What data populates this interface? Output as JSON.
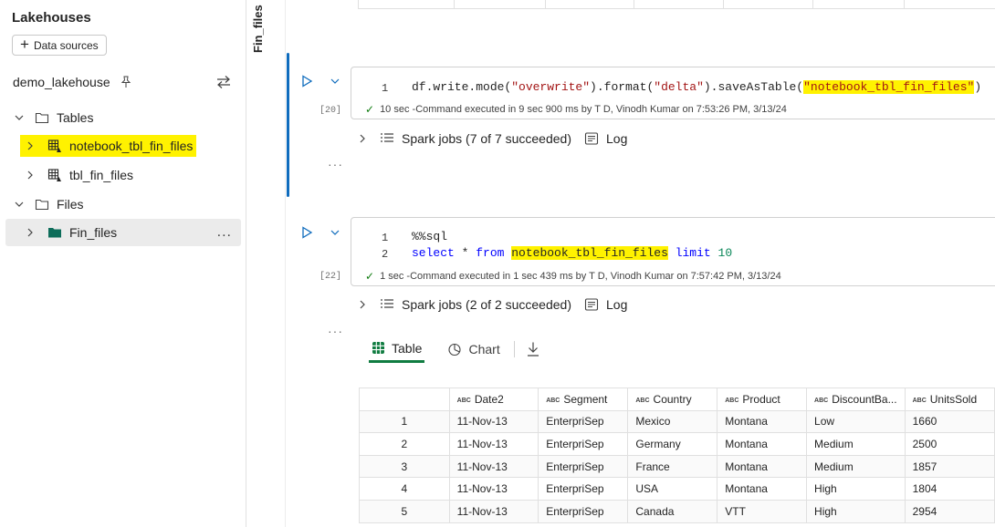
{
  "explorer": {
    "title": "Lakehouses",
    "data_sources_label": "Data sources",
    "lakehouse_name": "demo_lakehouse",
    "tables_label": "Tables",
    "tables": [
      "notebook_tbl_fin_files",
      "tbl_fin_files"
    ],
    "files_label": "Files",
    "files": [
      "Fin_files"
    ],
    "more_label": "..."
  },
  "side_tab": {
    "label": "Fin_files"
  },
  "cells": [
    {
      "exec_count": "[20]",
      "lines": [
        {
          "num": "1",
          "prefix": "df.write.mode(",
          "s1": "\"overwrite\"",
          "mid": ").format(",
          "s2": "\"delta\"",
          "mid2": ").saveAsTable(",
          "s3": "\"notebook_tbl_fin_files\"",
          "end": ")"
        }
      ],
      "status": "10 sec -Command executed in 9 sec 900 ms by T D, Vinodh Kumar on 7:53:26 PM, 3/13/24",
      "spark_jobs": "Spark jobs (7 of 7 succeeded)",
      "log_label": "Log"
    },
    {
      "exec_count": "[22]",
      "line1_num": "1",
      "line1": "%%sql",
      "line2_num": "2",
      "line2_kw1": "select",
      "line2_star": " * ",
      "line2_kw2": "from",
      "line2_table": "notebook_tbl_fin_files",
      "line2_kw3": "limit",
      "line2_num_val": "10",
      "status": "1 sec -Command executed in 1 sec 439 ms by T D, Vinodh Kumar on 7:57:42 PM, 3/13/24",
      "spark_jobs": "Spark jobs (2 of 2 succeeded)",
      "log_label": "Log"
    }
  ],
  "result_tabs": {
    "table": "Table",
    "chart": "Chart"
  },
  "result_table": {
    "type_badge": "ABC",
    "columns": [
      "Date2",
      "Segment",
      "Country",
      "Product",
      "DiscountBa...",
      "UnitsSold"
    ],
    "rows": [
      [
        "1",
        "11-Nov-13",
        "EnterpriSep",
        "Mexico",
        "Montana",
        "Low",
        "1660"
      ],
      [
        "2",
        "11-Nov-13",
        "EnterpriSep",
        "Germany",
        "Montana",
        "Medium",
        "2500"
      ],
      [
        "3",
        "11-Nov-13",
        "EnterpriSep",
        "France",
        "Montana",
        "Medium",
        "1857"
      ],
      [
        "4",
        "11-Nov-13",
        "EnterpriSep",
        "USA",
        "Montana",
        "High",
        "1804"
      ],
      [
        "5",
        "11-Nov-13",
        "EnterpriSep",
        "Canada",
        "VTT",
        "High",
        "2954"
      ]
    ]
  },
  "colors": {
    "highlight": "#fff200",
    "accent_blue": "#0f6cbd",
    "table_tab_green": "#107c41",
    "success": "#107c10"
  }
}
